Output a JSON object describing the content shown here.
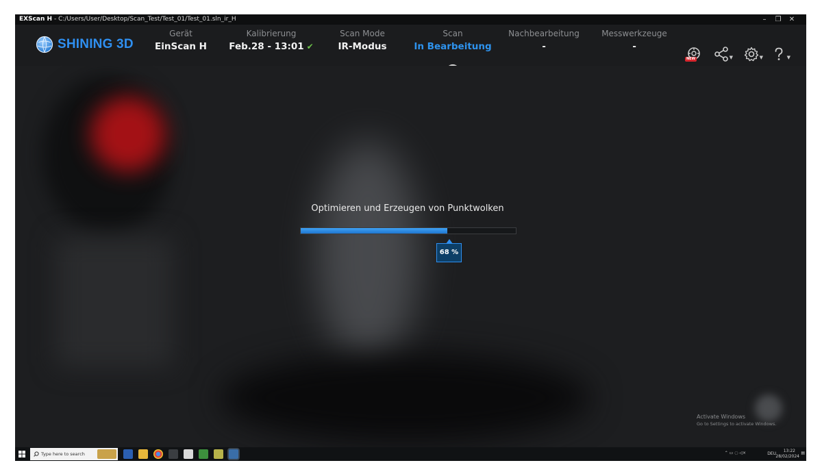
{
  "window": {
    "app_name": "EXScan H",
    "separator": "-",
    "path": "C:/Users/User/Desktop/Scan_Test/Test_01/Test_01.sln_ir_H",
    "minimize": "–",
    "restore": "❐",
    "close": "✕"
  },
  "header": {
    "logo_text": "SHINING 3D",
    "steps": [
      {
        "label": "Gerät",
        "value": "EinScan H"
      },
      {
        "label": "Kalibrierung",
        "value": "Feb.28 - 13:01"
      },
      {
        "label": "Scan Mode",
        "value": "IR-Modus"
      },
      {
        "label": "Scan",
        "value": "In Bearbeitung"
      },
      {
        "label": "Nachbearbeitung",
        "value": "-"
      },
      {
        "label": "Messwerkzeuge",
        "value": "-"
      }
    ],
    "new_badge": "NEW"
  },
  "progress": {
    "message": "Optimieren und Erzeugen von Punktwolken",
    "percent": 68,
    "percent_label": "68 %"
  },
  "activation": {
    "title": "Activate Windows",
    "subtitle": "Go to Settings to activate Windows."
  },
  "taskbar": {
    "search_placeholder": "Type here to search",
    "language": "DEU",
    "time": "13:22",
    "date": "28/02/2024"
  },
  "colors": {
    "accent": "#2f8ff0",
    "check": "#6cc24a",
    "badge": "#d7262d"
  }
}
